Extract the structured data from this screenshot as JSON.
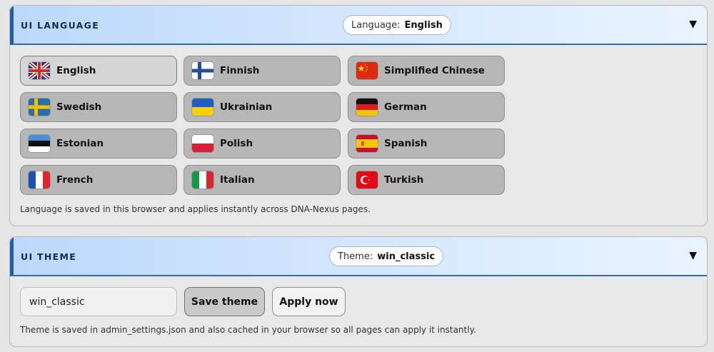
{
  "language_panel": {
    "title": "UI LANGUAGE",
    "pill_label": "Language:",
    "pill_value": "English",
    "collapse_icon": "▼",
    "note": "Language is saved in this browser and applies instantly across DNA-Nexus pages.",
    "languages": [
      {
        "label": "English",
        "flag": "uk-flag-icon",
        "active": true
      },
      {
        "label": "Finnish",
        "flag": "finland-flag-icon"
      },
      {
        "label": "Simplified Chinese",
        "flag": "china-flag-icon"
      },
      {
        "label": "Swedish",
        "flag": "sweden-flag-icon"
      },
      {
        "label": "Ukrainian",
        "flag": "ukraine-flag-icon"
      },
      {
        "label": "German",
        "flag": "germany-flag-icon"
      },
      {
        "label": "Estonian",
        "flag": "estonia-flag-icon"
      },
      {
        "label": "Polish",
        "flag": "poland-flag-icon"
      },
      {
        "label": "Spanish",
        "flag": "spain-flag-icon"
      },
      {
        "label": "French",
        "flag": "france-flag-icon"
      },
      {
        "label": "Italian",
        "flag": "italy-flag-icon"
      },
      {
        "label": "Turkish",
        "flag": "turkey-flag-icon"
      }
    ]
  },
  "theme_panel": {
    "title": "UI THEME",
    "pill_label": "Theme:",
    "pill_value": "win_classic",
    "collapse_icon": "▼",
    "input_value": "win_classic",
    "save_label": "Save theme",
    "apply_label": "Apply now",
    "note": "Theme is saved in admin_settings.json and also cached in your browser so all pages can apply it instantly."
  },
  "colors": {
    "accent": "#1f5ea8",
    "header_gradient_start": "#bcd8fb",
    "button_bg": "#b7b7b7"
  }
}
